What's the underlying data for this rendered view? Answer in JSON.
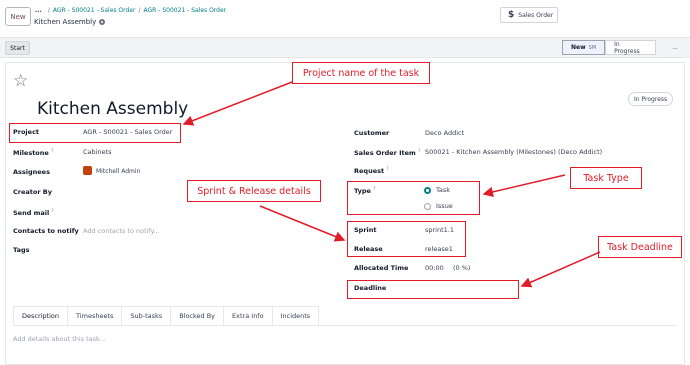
{
  "topbar": {
    "new_label": "New",
    "breadcrumb_dots": "...",
    "breadcrumbs": [
      "AGR - S00021 - Sales Order",
      "AGR - S00021 - Sales Order"
    ],
    "page_title": "Kitchen Assembly",
    "smart_button_label": "Sales Order",
    "smart_button_icon": "dollar-icon"
  },
  "actionbar": {
    "start_label": "Start",
    "stages": [
      {
        "label": "New",
        "tag": "SM",
        "active": true
      },
      {
        "label": "In Progress",
        "tag": "",
        "active": false
      }
    ],
    "more_label": "..."
  },
  "task": {
    "title": "Kitchen Assembly",
    "state_badge": "In Progress"
  },
  "fields_left": {
    "project": {
      "label": "Project",
      "value": "AGR - S00021 - Sales Order"
    },
    "milestone": {
      "label": "Milestone",
      "help": "?",
      "value": "Cabinets"
    },
    "assignees": {
      "label": "Assignees",
      "value": "Mitchell Admin"
    },
    "creator": {
      "label": "Creator By",
      "value": ""
    },
    "send_mail": {
      "label": "Send mail",
      "help": "?",
      "value": ""
    },
    "contacts": {
      "label": "Contacts to notify",
      "placeholder": "Add contacts to notify..."
    },
    "tags": {
      "label": "Tags",
      "value": ""
    }
  },
  "fields_right": {
    "customer": {
      "label": "Customer",
      "value": "Deco Addict"
    },
    "sales_order_item": {
      "label": "Sales Order Item",
      "help": "?",
      "value": "S00021 - Kitchen Assembly (Milestones) (Deco Addict)"
    },
    "request": {
      "label": "Request",
      "help": "?",
      "value": ""
    },
    "type": {
      "label": "Type",
      "help": "?",
      "options": [
        "Task",
        "Issue"
      ],
      "selected": "Task"
    },
    "sprint": {
      "label": "Sprint",
      "value": "sprint1.1"
    },
    "release": {
      "label": "Release",
      "value": "release1"
    },
    "allocated_time": {
      "label": "Allocated Time",
      "value": "00:00",
      "percent": "(0 %)"
    },
    "deadline": {
      "label": "Deadline",
      "value": ""
    }
  },
  "tabs": [
    "Description",
    "Timesheets",
    "Sub-tasks",
    "Blocked By",
    "Extra Info",
    "Incidents"
  ],
  "description_placeholder": "Add details about this task...",
  "annotations": {
    "project_name": "Project name of the task",
    "sprint_release": "Sprint & Release details",
    "task_type": "Task Type",
    "task_deadline": "Task Deadline",
    "color": "#e11d2a"
  },
  "colors": {
    "accent": "#017e84",
    "brand": "#714b67"
  }
}
